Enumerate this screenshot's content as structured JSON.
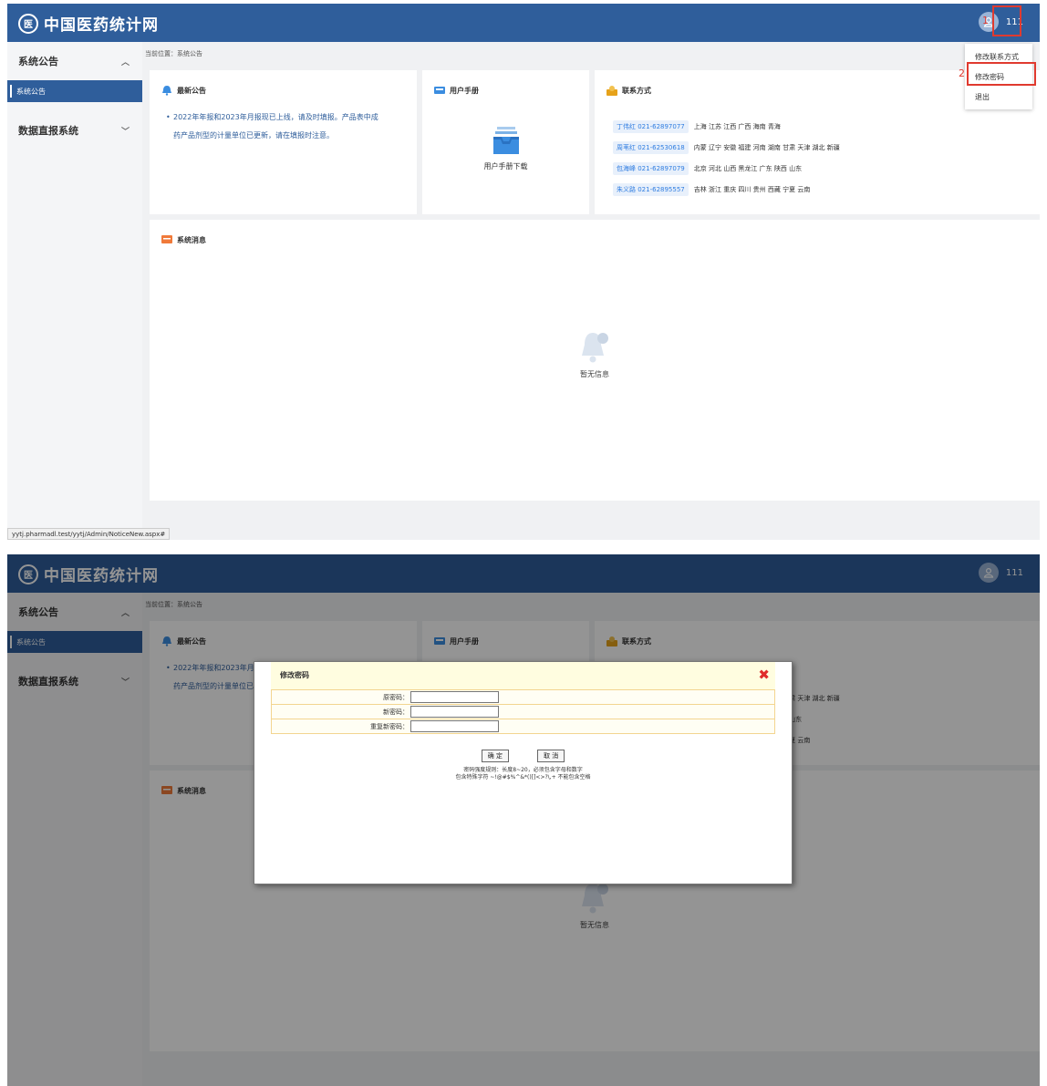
{
  "header": {
    "logo_mark": "医",
    "logo_text": "中国医药统计网",
    "username": "111"
  },
  "sidebar": {
    "group1": "系统公告",
    "group1_item": "系统公告",
    "group2": "数据直报系统"
  },
  "breadcrumb": "当前位置：系统公告",
  "notice": {
    "title": "最新公告",
    "line1": "2022年年报和2023年月报现已上线，请及时填报。产品表中成",
    "line2": "药产品剂型的计量单位已更新，请在填报时注意。"
  },
  "manual": {
    "title": "用户手册",
    "download": "用户手册下载"
  },
  "contact": {
    "title": "联系方式",
    "rows": [
      {
        "contact": "丁伟红  021-62897077",
        "regions": "上海 江苏 江西 广西 海南 青海"
      },
      {
        "contact": "周苇红  021-62530618",
        "regions": "内蒙 辽宁 安徽 福建 河南 湖南 甘肃 天津 湖北 新疆"
      },
      {
        "contact": "包海峰  021-62897079",
        "regions": "北京 河北 山西 黑龙江 广东 陕西 山东"
      },
      {
        "contact": "朱义路  021-62895557",
        "regions": "吉林 浙江 重庆 四川 贵州 西藏 宁夏 云南"
      }
    ]
  },
  "messages": {
    "title": "系统消息",
    "empty": "暂无信息"
  },
  "dropdown": {
    "items": [
      "修改联系方式",
      "修改密码",
      "退出"
    ]
  },
  "annotations": {
    "step1": "1",
    "step2": "2"
  },
  "status_url": "yytj.pharmadl.test/yytj/Admin/NoticeNew.aspx#",
  "modal": {
    "title": "修改密码",
    "close": "✖",
    "fields": [
      {
        "label": "原密码：",
        "value": ""
      },
      {
        "label": "新密码：",
        "value": ""
      },
      {
        "label": "重复新密码：",
        "value": ""
      }
    ],
    "confirm": "确 定",
    "cancel": "取 消",
    "rule1": "密码强度规则：长度8~20，必须包含字母和数字",
    "rule2": "包含特殊字符 ~!@#$%^&*()[]<>?\\,+ 不能包含空格"
  },
  "colors": {
    "header": "#2f5e9b",
    "accent_red": "#e03a2f",
    "link_blue": "#2f7de1"
  }
}
